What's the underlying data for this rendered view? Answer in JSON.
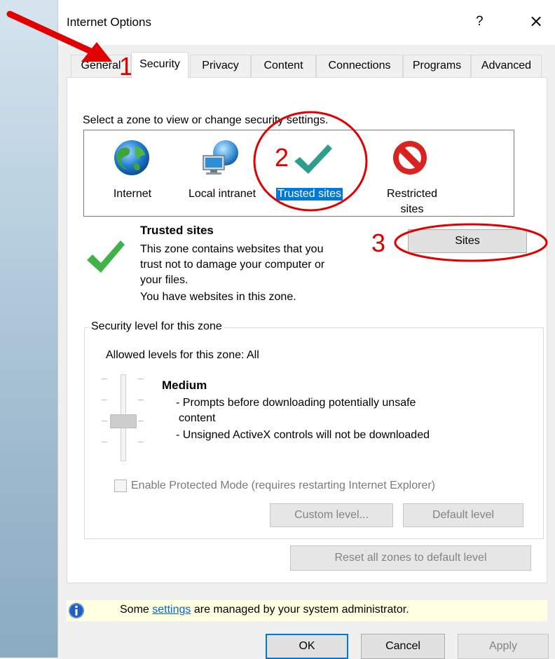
{
  "window": {
    "title": "Internet Options",
    "help": "?",
    "close": "×"
  },
  "tabs": [
    "General",
    "Security",
    "Privacy",
    "Content",
    "Connections",
    "Programs",
    "Advanced"
  ],
  "security": {
    "zone_prompt": "Select a zone to view or change security settings.",
    "zones": [
      {
        "label": "Internet",
        "icon": "globe-icon"
      },
      {
        "label": "Local intranet",
        "icon": "intranet-icon"
      },
      {
        "label": "Trusted sites",
        "icon": "checkmark-icon",
        "selected": true
      },
      {
        "label": "Restricted sites",
        "label_line1": "Restricted",
        "label_line2": "sites",
        "icon": "prohibited-icon"
      }
    ],
    "zone_title": "Trusted sites",
    "zone_desc_lines": [
      "This zone contains websites that you",
      "trust not to damage your computer or",
      "your files.",
      "You have websites in this zone."
    ],
    "sites_button": "Sites",
    "level_group_title": "Security level for this zone",
    "allowed_levels": "Allowed levels for this zone: All",
    "level_name": "Medium",
    "level_desc_lines": [
      "- Prompts before downloading potentially unsafe",
      "content",
      "- Unsigned ActiveX controls will not be downloaded"
    ],
    "protected_mode_label": "Enable Protected Mode (requires restarting Internet Explorer)",
    "protected_mode_checked": false,
    "custom_level_button": "Custom level...",
    "default_level_button": "Default level",
    "reset_button": "Reset all zones to default level"
  },
  "info": {
    "prefix": "Some ",
    "link": "settings",
    "suffix": " are managed by your system administrator."
  },
  "buttons": {
    "ok": "OK",
    "cancel": "Cancel",
    "apply": "Apply"
  },
  "annotations": {
    "step1": "1",
    "step2": "2",
    "step3": "3",
    "color": "#e00000"
  },
  "colors": {
    "selection": "#0078d7",
    "info_bg": "#ffffe1",
    "check_green": "#33a852"
  }
}
